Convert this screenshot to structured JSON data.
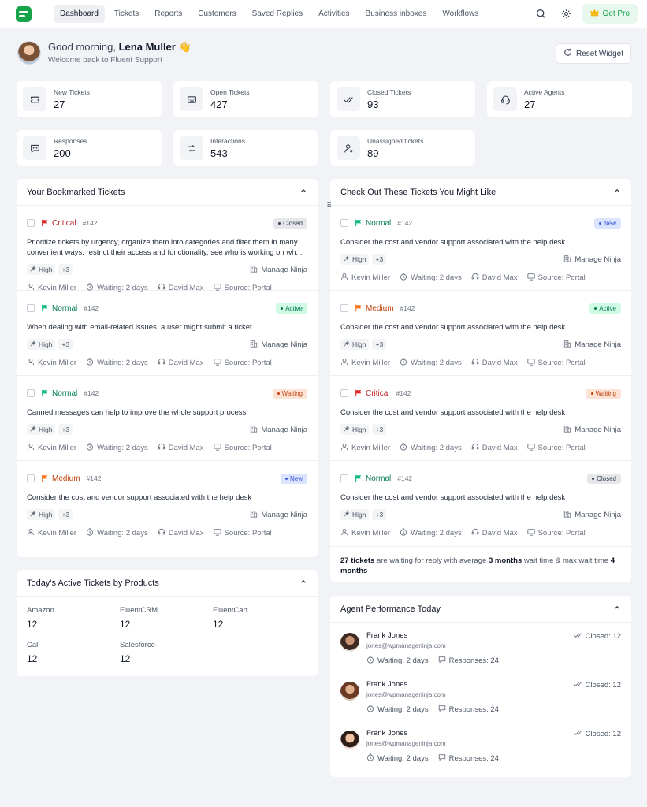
{
  "nav": {
    "items": [
      "Dashboard",
      "Tickets",
      "Reports",
      "Customers",
      "Saved Replies",
      "Activities",
      "Business inboxes",
      "Workflows"
    ],
    "active": "Dashboard",
    "get_pro": "Get Pro"
  },
  "greeting": {
    "prefix": "Good morning, ",
    "name": "Lena Muller",
    "emoji": "👋",
    "subtitle": "Welcome back to Fluent Support",
    "reset": "Reset Widget"
  },
  "stats": [
    {
      "label": "New Tickets",
      "value": "27",
      "icon": "ticket-icon"
    },
    {
      "label": "Open Tickets",
      "value": "427",
      "icon": "open-ticket-icon"
    },
    {
      "label": "Closed Tickets",
      "value": "93",
      "icon": "double-check-icon"
    },
    {
      "label": "Active Agents",
      "value": "27",
      "icon": "headset-icon"
    },
    {
      "label": "Responses",
      "value": "200",
      "icon": "chat-icon"
    },
    {
      "label": "Interactions",
      "value": "543",
      "icon": "exchange-icon"
    },
    {
      "label": "Unassigned tickets",
      "value": "89",
      "icon": "user-x-icon"
    }
  ],
  "bookmarked": {
    "title": "Your Bookmarked Tickets",
    "tickets": [
      {
        "priority": "Critical",
        "color": "#dc2626",
        "id": "#142",
        "status": "Closed",
        "status_bg": "#e5e7eb",
        "status_fg": "#374151",
        "title": "Prioritize tickets by urgency, organize them into categories and filter them in many convenient ways. restrict their access and functionality, see who is working on wh...",
        "tag": "High",
        "more": "+3",
        "company": "Manage Ninja",
        "customer": "Kevin Miller",
        "waiting": "Waiting: 2 days",
        "agent": "David Max",
        "source": "Source: Portal"
      },
      {
        "priority": "Normal",
        "color": "#10b981",
        "id": "#142",
        "status": "Active",
        "status_bg": "#d1fae5",
        "status_fg": "#047857",
        "title": "When dealing with email-related issues, a user might submit a ticket",
        "tag": "High",
        "more": "+3",
        "company": "Manage Ninja",
        "customer": "Kevin Miller",
        "waiting": "Waiting: 2 days",
        "agent": "David Max",
        "source": "Source: Portal"
      },
      {
        "priority": "Normal",
        "color": "#10b981",
        "id": "#142",
        "status": "Waiting",
        "status_bg": "#fde3d6",
        "status_fg": "#c2410c",
        "title": "Canned messages can help to improve the whole support process",
        "tag": "High",
        "more": "+3",
        "company": "Manage Ninja",
        "customer": "Kevin Miller",
        "waiting": "Waiting: 2 days",
        "agent": "David Max",
        "source": "Source: Portal"
      },
      {
        "priority": "Medium",
        "color": "#f97316",
        "id": "#142",
        "status": "New",
        "status_bg": "#dbe4ff",
        "status_fg": "#3b5bdb",
        "title": "Consider the cost and vendor support associated with the help desk",
        "tag": "High",
        "more": "+3",
        "company": "Manage Ninja",
        "customer": "Kevin Miller",
        "waiting": "Waiting: 2 days",
        "agent": "David Max",
        "source": "Source: Portal"
      }
    ]
  },
  "suggested": {
    "title": "Check Out These Tickets You Might Like",
    "tickets": [
      {
        "priority": "Normal",
        "color": "#10b981",
        "id": "#142",
        "status": "New",
        "status_bg": "#dbe4ff",
        "status_fg": "#3b5bdb",
        "title": "Consider the cost and vendor support associated with the help desk",
        "tag": "High",
        "more": "+3",
        "company": "Manage Ninja",
        "customer": "Kevin Miller",
        "waiting": "Waiting: 2 days",
        "agent": "David Max",
        "source": "Source: Portal"
      },
      {
        "priority": "Medium",
        "color": "#f97316",
        "id": "#142",
        "status": "Active",
        "status_bg": "#d1fae5",
        "status_fg": "#047857",
        "title": "Consider the cost and vendor support associated with the help desk",
        "tag": "High",
        "more": "+3",
        "company": "Manage Ninja",
        "customer": "Kevin Miller",
        "waiting": "Waiting: 2 days",
        "agent": "David Max",
        "source": "Source: Portal"
      },
      {
        "priority": "Critical",
        "color": "#dc2626",
        "id": "#142",
        "status": "Waiting",
        "status_bg": "#fde3d6",
        "status_fg": "#c2410c",
        "title": "Consider the cost and vendor support associated with the help desk",
        "tag": "High",
        "more": "+3",
        "company": "Manage Ninja",
        "customer": "Kevin Miller",
        "waiting": "Waiting: 2 days",
        "agent": "David Max",
        "source": "Source: Portal"
      },
      {
        "priority": "Normal",
        "color": "#10b981",
        "id": "#142",
        "status": "Closed",
        "status_bg": "#e5e7eb",
        "status_fg": "#374151",
        "title": "Consider the cost and vendor support associated with the help desk",
        "tag": "High",
        "more": "+3",
        "company": "Manage Ninja",
        "customer": "Kevin Miller",
        "waiting": "Waiting: 2 days",
        "agent": "David Max",
        "source": "Source: Portal"
      }
    ],
    "summary": {
      "count": "27 tickets",
      "mid": " are waiting for reply with average ",
      "avg": "3 months",
      "mid2": " wait time & max wait time ",
      "max": "4 months"
    }
  },
  "products": {
    "title": "Today's Active Tickets by Products",
    "items": [
      {
        "name": "Amazon",
        "value": "12"
      },
      {
        "name": "FluentCRM",
        "value": "12"
      },
      {
        "name": "FluentCart",
        "value": "12"
      },
      {
        "name": "Cal",
        "value": "12"
      },
      {
        "name": "Salesforce",
        "value": "12"
      }
    ]
  },
  "agents": {
    "title": "Agent Performance Today",
    "items": [
      {
        "name": "Frank Jones",
        "email": "jones@wpmanageninja.com",
        "waiting": "Waiting: 2 days",
        "responses": "Responses: 24",
        "closed": "Closed: 12"
      },
      {
        "name": "Frank Jones",
        "email": "jones@wpmanageninja.com",
        "waiting": "Waiting: 2 days",
        "responses": "Responses: 24",
        "closed": "Closed: 12"
      },
      {
        "name": "Frank Jones",
        "email": "jones@wpmanageninja.com",
        "waiting": "Waiting: 2 days",
        "responses": "Responses: 24",
        "closed": "Closed: 12"
      }
    ]
  }
}
